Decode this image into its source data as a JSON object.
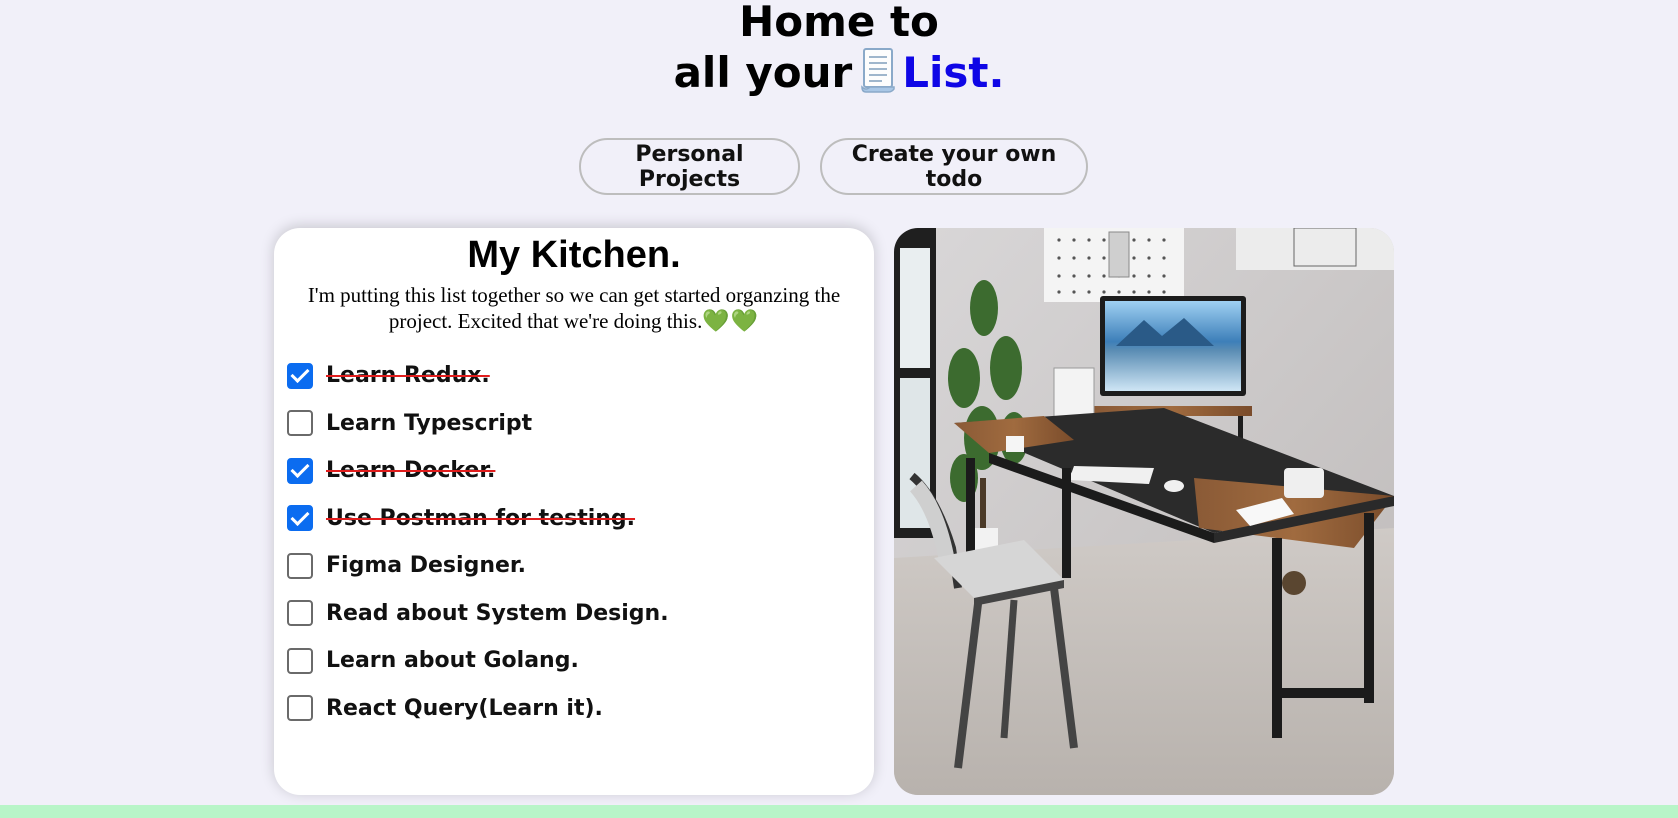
{
  "hero": {
    "line1": "Home to",
    "line2_prefix": "all your",
    "line2_accent": "List.",
    "icon": "document-icon",
    "accent_color": "#0f06e6"
  },
  "nav": {
    "personal_projects": "Personal Projects",
    "create_todo": "Create your own todo"
  },
  "card": {
    "title": "My Kitchen.",
    "description": "I'm putting this list together so we can get started organzing the project. Excited that we're doing this.",
    "description_emoji": "💚💚",
    "todos": [
      {
        "label": "Learn Redux.",
        "done": true
      },
      {
        "label": "Learn Typescript",
        "done": false
      },
      {
        "label": "Learn Docker.",
        "done": true
      },
      {
        "label": "Use Postman for testing.",
        "done": true
      },
      {
        "label": "Figma Designer.",
        "done": false
      },
      {
        "label": "Read about System Design.",
        "done": false
      },
      {
        "label": "Learn about Golang.",
        "done": false
      },
      {
        "label": "React Query(Learn it).",
        "done": false
      }
    ]
  },
  "image": {
    "subject": "home office desk with monitor, keyboard, phone, chair and plant"
  },
  "colors": {
    "background": "#f1f0f9",
    "checkbox_checked": "#0b6cf0",
    "strike": "#e11d1d",
    "footer": "#b8f5c8"
  }
}
